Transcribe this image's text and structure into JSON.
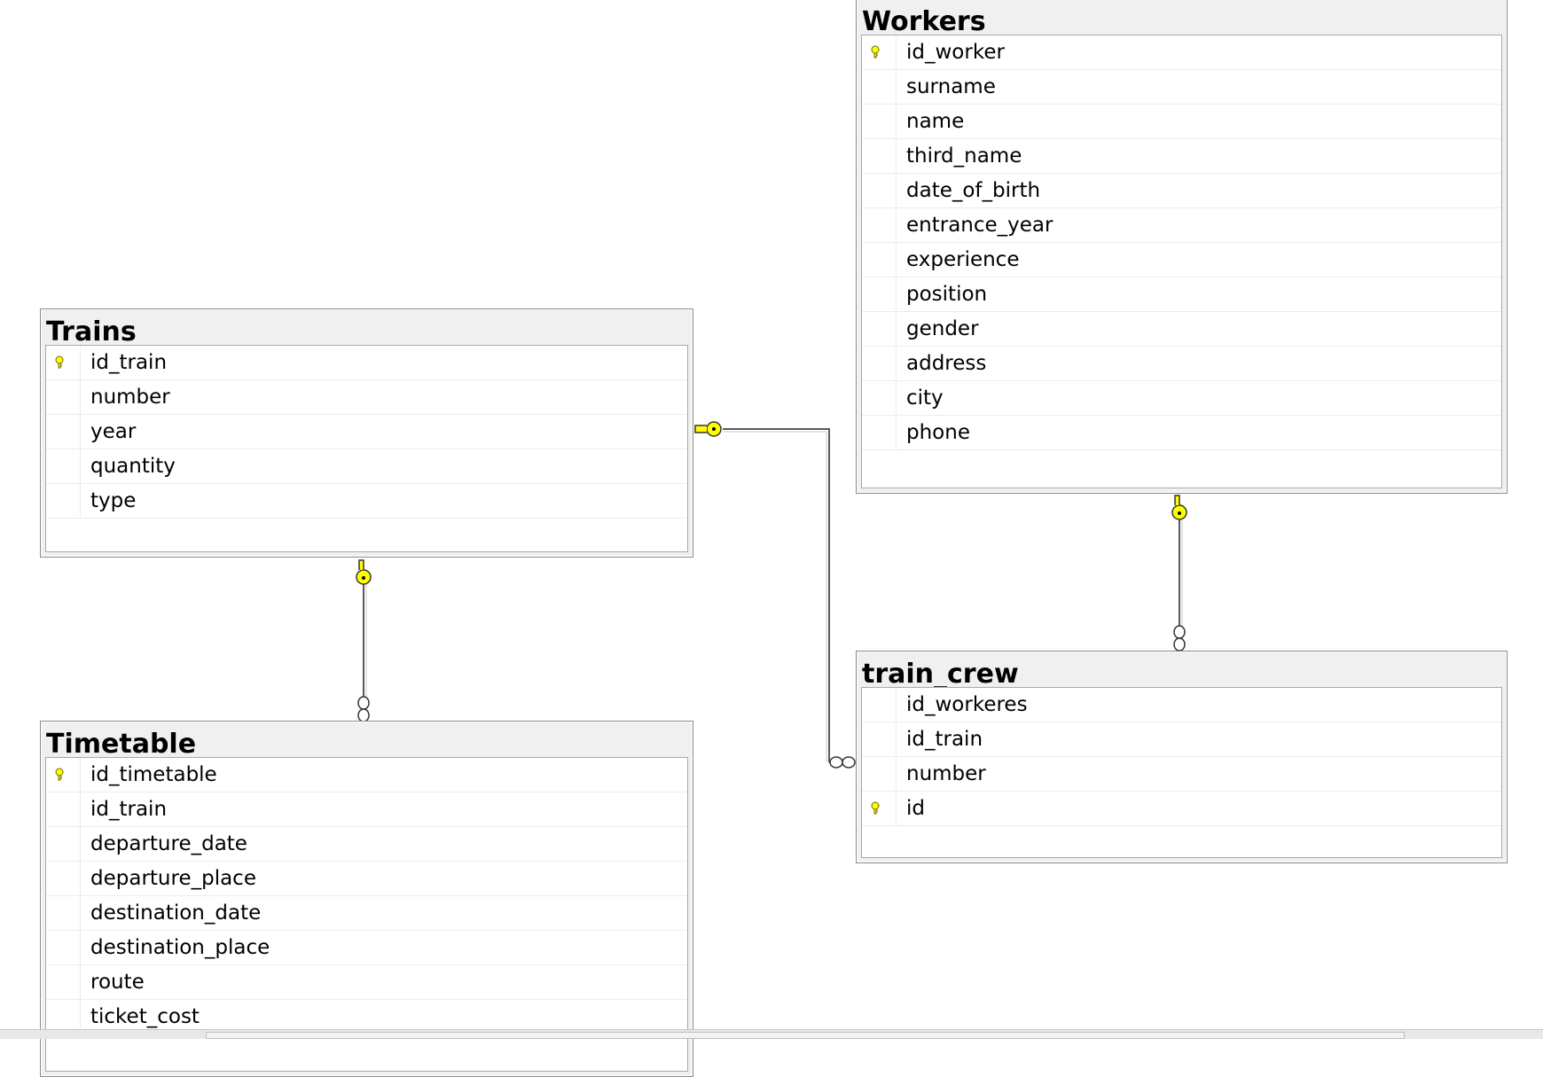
{
  "tables": {
    "workers": {
      "title": "Workers",
      "columns": [
        {
          "name": "id_worker",
          "pk": true
        },
        {
          "name": "surname",
          "pk": false
        },
        {
          "name": "name",
          "pk": false
        },
        {
          "name": "third_name",
          "pk": false
        },
        {
          "name": "date_of_birth",
          "pk": false
        },
        {
          "name": "entrance_year",
          "pk": false
        },
        {
          "name": "experience",
          "pk": false
        },
        {
          "name": "position",
          "pk": false
        },
        {
          "name": "gender",
          "pk": false
        },
        {
          "name": "address",
          "pk": false
        },
        {
          "name": "city",
          "pk": false
        },
        {
          "name": "phone",
          "pk": false
        }
      ]
    },
    "trains": {
      "title": "Trains",
      "columns": [
        {
          "name": "id_train",
          "pk": true
        },
        {
          "name": "number",
          "pk": false
        },
        {
          "name": "year",
          "pk": false
        },
        {
          "name": "quantity",
          "pk": false
        },
        {
          "name": "type",
          "pk": false
        }
      ]
    },
    "timetable": {
      "title": "Timetable",
      "columns": [
        {
          "name": "id_timetable",
          "pk": true
        },
        {
          "name": "id_train",
          "pk": false
        },
        {
          "name": "departure_date",
          "pk": false
        },
        {
          "name": "departure_place",
          "pk": false
        },
        {
          "name": "destination_date",
          "pk": false
        },
        {
          "name": "destination_place",
          "pk": false
        },
        {
          "name": "route",
          "pk": false
        },
        {
          "name": "ticket_cost",
          "pk": false
        }
      ]
    },
    "train_crew": {
      "title": "train_crew",
      "columns": [
        {
          "name": "id_workeres",
          "pk": false
        },
        {
          "name": "id_train",
          "pk": false
        },
        {
          "name": "number",
          "pk": false
        },
        {
          "name": "id",
          "pk": true
        }
      ]
    }
  },
  "relationships": [
    {
      "from": "Trains",
      "to": "Timetable",
      "one_end": "key",
      "many_end": "infinity"
    },
    {
      "from": "Trains",
      "to": "train_crew",
      "one_end": "key",
      "many_end": "infinity"
    },
    {
      "from": "Workers",
      "to": "train_crew",
      "one_end": "key",
      "many_end": "infinity"
    }
  ],
  "icons": {
    "primary_key": "key-icon",
    "one_end": "key-icon",
    "many_end": "infinity-icon"
  },
  "colors": {
    "key_fill": "#ffff00",
    "key_stroke": "#6b6b00",
    "connector": "#5a5a5a"
  }
}
